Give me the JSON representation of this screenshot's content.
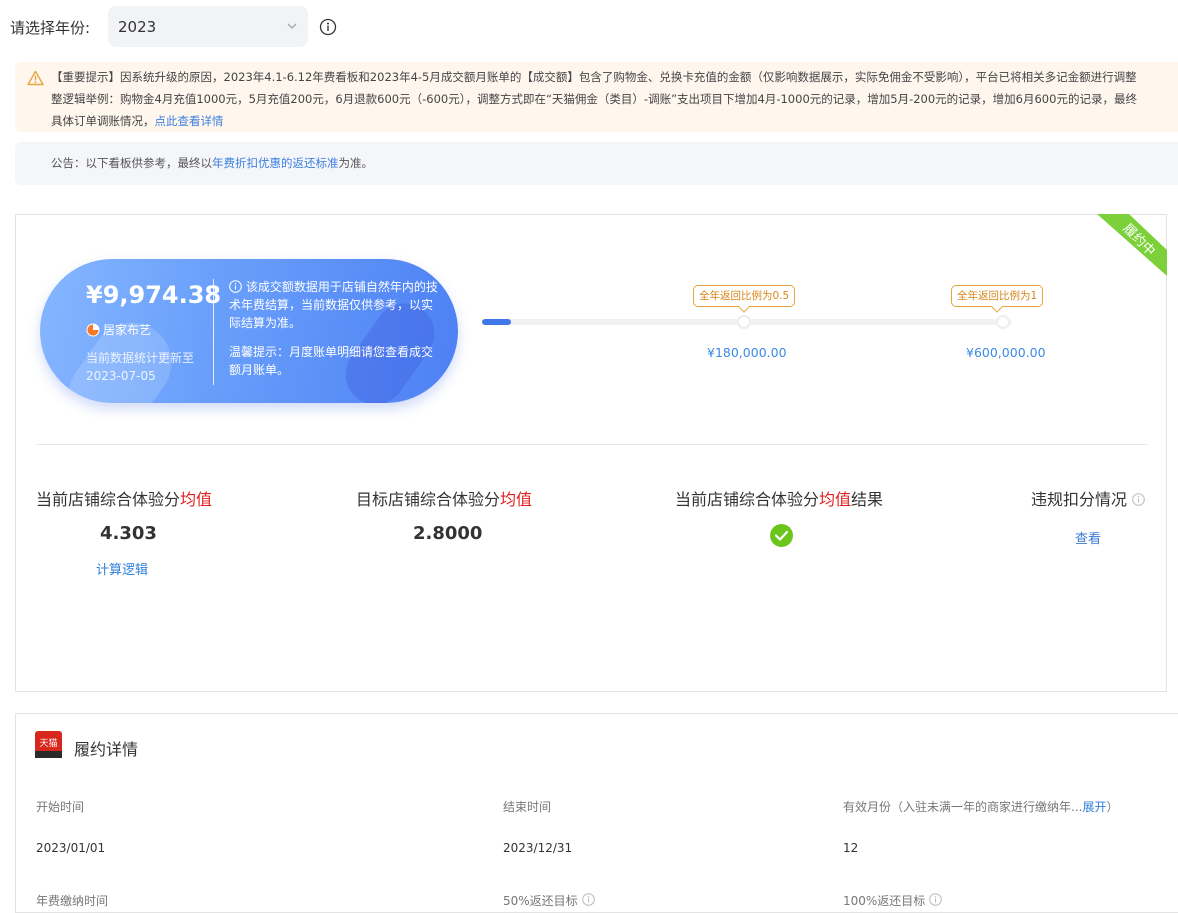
{
  "year_selector": {
    "label": "请选择年份:",
    "value": "2023"
  },
  "notice": {
    "line1": "【重要提示】因系统升级的原因，2023年4.1-6.12年费看板和2023年4-5月成交额月账单的【成交额】包含了购物金、兑换卡充值的金额（仅影响数据展示，实际免佣金不受影响），平台已将相关多记金额进行调整",
    "line2": "整逻辑举例：购物金4月充值1000元，5月充值200元，6月退款600元（-600元），调整方式即在“天猫佣金（类目）-调账”支出项目下增加4月-1000元的记录，增加5月-200元的记录，增加6月600元的记录，最终",
    "line3_text": "具体订单调账情况，",
    "line3_link": "点此查看详情"
  },
  "announcement": {
    "prefix": "公告：以下看板供参考，最终以",
    "link": "年费折扣优惠的返还标准",
    "suffix": "为准。"
  },
  "status_ribbon": "履约中",
  "summary": {
    "amount": "¥9,974.38",
    "shop_name": "居家布艺",
    "update_line1": "当前数据统计更新至",
    "update_date": "2023-07-05",
    "note": "该成交额数据用于店铺自然年内的技术年费结算，当前数据仅供参考，以实际结算为准。",
    "tip": "温馨提示：月度账单明细请您查看成交额月账单。"
  },
  "progress": {
    "fraction": 0.055,
    "milestones": [
      {
        "tag": "全年返回比例为0.5",
        "amount": "¥180,000.00"
      },
      {
        "tag": "全年返回比例为1",
        "amount": "¥600,000.00"
      }
    ]
  },
  "metrics": [
    {
      "title_prefix": "当前店铺综合体验分",
      "title_red": "均值",
      "title_suffix": "",
      "value": "4.303",
      "link": "计算逻辑"
    },
    {
      "title_prefix": "目标店铺综合体验分",
      "title_red": "均值",
      "title_suffix": "",
      "value": "2.8000"
    },
    {
      "title_prefix": "当前店铺综合体验分",
      "title_red": "均值",
      "title_suffix": "结果",
      "result": "pass"
    },
    {
      "title_prefix": "违规扣分情况",
      "link": "查看"
    }
  ],
  "detail": {
    "title": "履约详情",
    "logo_text": "天猫",
    "fields": [
      {
        "label": "开始时间",
        "value": "2023/01/01"
      },
      {
        "label": "结束时间",
        "value": "2023/12/31"
      },
      {
        "label": "有效月份（入驻未满一年的商家进行缴纳年...",
        "expand": "展开",
        "label_suffix": "）",
        "value": "12"
      }
    ],
    "row2": [
      "年费缴纳时间",
      "50%返还目标",
      "100%返还目标"
    ]
  },
  "colors": {
    "accent": "#3d7fe0",
    "success": "#6bc51a",
    "warning": "#e5a63b",
    "danger": "#e02020",
    "ribbon": "#7cd13a"
  }
}
